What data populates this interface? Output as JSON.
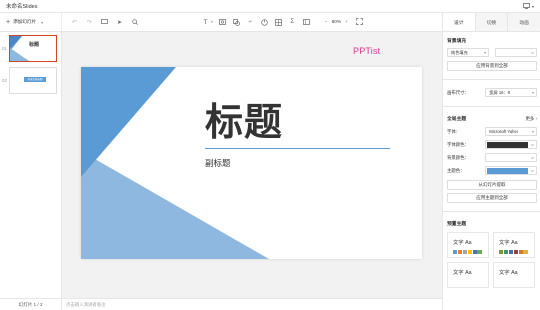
{
  "window": {
    "title": "未命名Slides"
  },
  "toolbar": {
    "new_page_label": "添加幻灯片",
    "zoom_level": "80%"
  },
  "thumbnails": [
    {
      "number": "01",
      "title": "标题",
      "active": true
    },
    {
      "number": "02",
      "label": "目录页面标题",
      "active": false
    }
  ],
  "status": {
    "slide_counter": "幻灯片 1 / 2"
  },
  "notes": {
    "placeholder": "点击输入演讲者备注"
  },
  "canvas": {
    "watermark": "PPTist"
  },
  "slide": {
    "title": "标题",
    "subtitle": "副标题",
    "colors": {
      "dark_blue": "#5b9bd5",
      "light_blue": "#8eb8e0",
      "line": "#5b9bd5"
    }
  },
  "panel": {
    "tabs": [
      "设计",
      "切换",
      "动画"
    ],
    "background": {
      "section_title": "背景填充",
      "fill_type": "纯色填充",
      "fill_color": "#ffffff",
      "apply_all_label": "应用背景到全部"
    },
    "size": {
      "label": "画布尺寸：",
      "value": "宽屏 16：9"
    },
    "theme": {
      "section_title": "全局主题",
      "more_label": "更多",
      "font_label": "字体：",
      "font_value": "Microsoft Yahei",
      "font_color_label": "字体颜色：",
      "font_color": "#333333",
      "bg_color_label": "背景颜色：",
      "bg_color": "#ffffff",
      "theme_color_label": "主题色：",
      "theme_color": "#5b9bd5",
      "extract_label": "从幻灯片提取",
      "apply_theme_label": "应用主题到全部"
    },
    "presets": {
      "section_title": "预置主题",
      "items": [
        {
          "text": "文字 Aa",
          "colors": [
            "#5b9bd5",
            "#ed7d31",
            "#a5a5a5",
            "#ffc000",
            "#4472c4",
            "#70ad47"
          ]
        },
        {
          "text": "文字 Aa",
          "colors": [
            "#83992a",
            "#3c9670",
            "#44709d",
            "#a23b32",
            "#d87728",
            "#deb340"
          ]
        },
        {
          "text": "文字 Aa",
          "colors": []
        },
        {
          "text": "文字 Aa",
          "colors": []
        }
      ]
    }
  }
}
